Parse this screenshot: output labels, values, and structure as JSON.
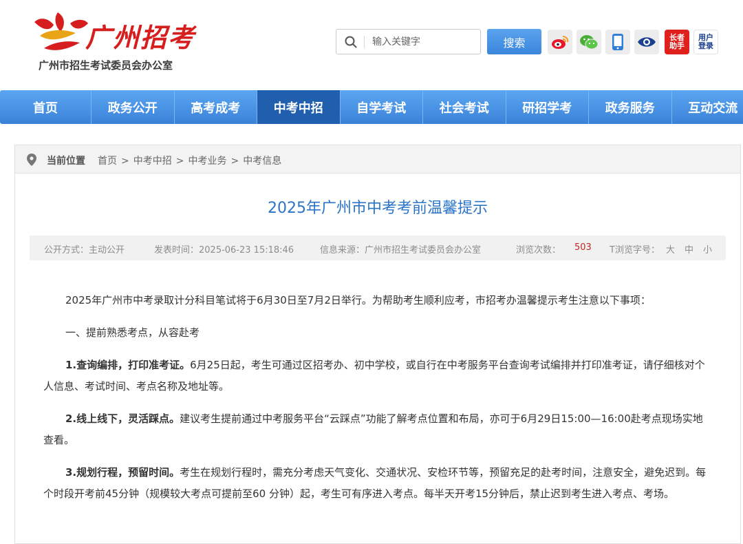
{
  "header": {
    "logo_title": "广州招考",
    "logo_subtitle": "广州市招生考试委员会办公室",
    "search": {
      "placeholder": "输入关键字",
      "button_label": "搜索"
    },
    "tools": [
      {
        "icon": "weibo-icon"
      },
      {
        "icon": "wechat-icon"
      },
      {
        "icon": "mobile-icon"
      },
      {
        "icon": "eye-icon"
      },
      {
        "icon": "elder-assistant-icon",
        "label_line1": "长者",
        "label_line2": "助手"
      },
      {
        "icon": "user-login-icon",
        "label_line1": "用户",
        "label_line2": "登录"
      }
    ]
  },
  "nav": {
    "items": [
      "首页",
      "政务公开",
      "高考成考",
      "中考中招",
      "自学考试",
      "社会考试",
      "研招学考",
      "政务服务",
      "互动交流"
    ],
    "active": "中考中招"
  },
  "breadcrumb": {
    "label": "当前位置",
    "items": [
      "首页",
      "中考中招",
      "中考业务",
      "中考信息"
    ]
  },
  "article": {
    "title": "2025年广州市中考考前温馨提示",
    "meta": {
      "disclosure": "公开方式：主动公开",
      "published": "发表时间：2025-06-23 15:18:46",
      "source": "信息来源：广州市招生考试委员会办公室",
      "views_label": "浏览次数：",
      "views": "503",
      "font_label": "T浏览字号：",
      "font_large": "大",
      "font_medium": "中",
      "font_small": "小"
    },
    "paragraphs": [
      {
        "bold": "",
        "text": "2025年广州市中考录取计分科目笔试将于6月30日至7月2日举行。为帮助考生顺利应考，市招考办温馨提示考生注意以下事项："
      },
      {
        "bold": "",
        "text": "一、提前熟悉考点，从容赴考"
      },
      {
        "bold": "1.查询编排，打印准考证。",
        "text": "6月25日起，考生可通过区招考办、初中学校，或自行在中考服务平台查询考试编排并打印准考证，请仔细核对个人信息、考试时间、考点名称及地址等。"
      },
      {
        "bold": "2.线上线下，灵活踩点。",
        "text": "建议考生提前通过中考服务平台“云踩点”功能了解考点位置和布局，亦可于6月29日15:00—16:00赴考点现场实地查看。"
      },
      {
        "bold": "3.规划行程，预留时间。",
        "text": "考生在规划行程时，需充分考虑天气变化、交通状况、安检环节等，预留充足的赴考时间，注意安全，避免迟到。每个时段开考前45分钟（规模较大考点可提前至60 分钟）起，考生可有序进入考点。每半天开考15分钟后，禁止迟到考生进入考点、考场。"
      }
    ]
  },
  "colors": {
    "brand_red": "#d71e1e",
    "nav_blue": "#3a82d8",
    "nav_active": "#1f5fad",
    "title_blue": "#2a74c8",
    "views_red": "#c4261e"
  }
}
